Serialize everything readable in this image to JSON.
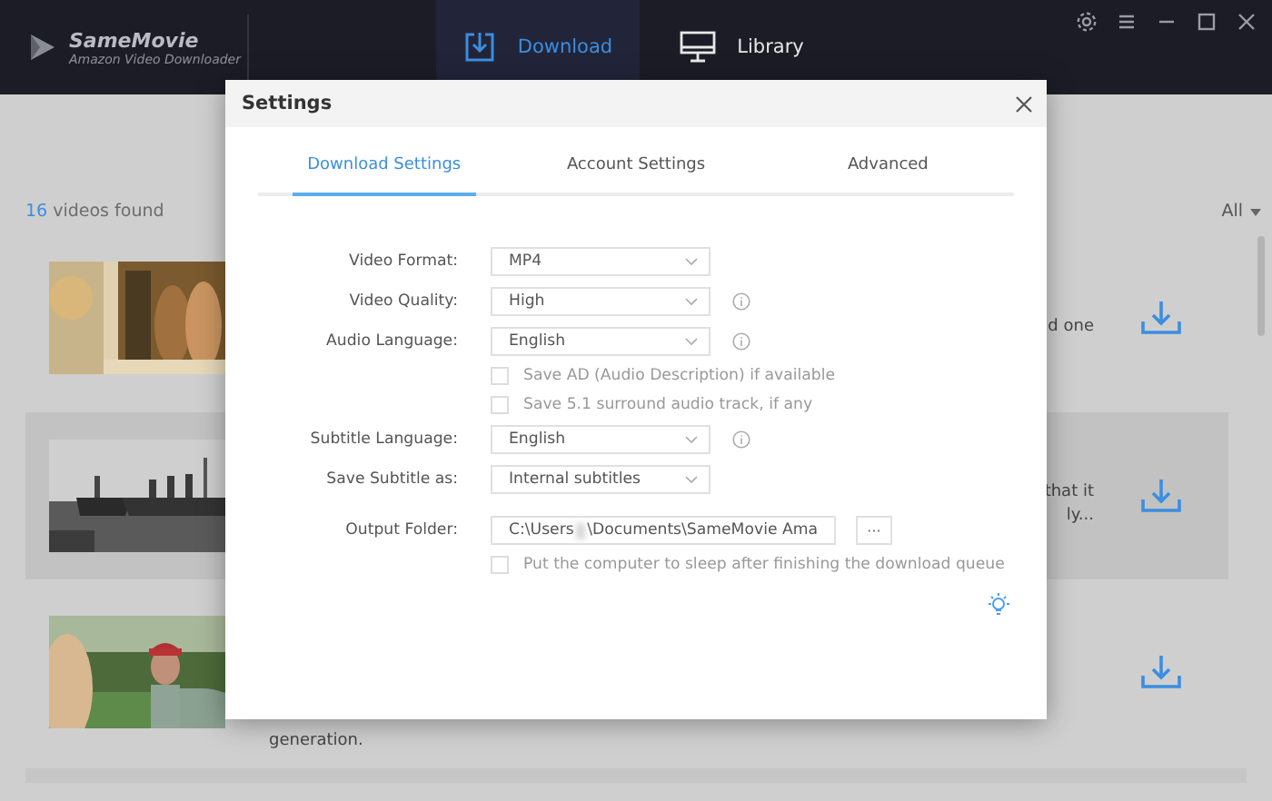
{
  "app": {
    "name": "SameMovie",
    "subtitle": "Amazon Video Downloader"
  },
  "nav_tabs": [
    {
      "label": "Download",
      "selected": true
    },
    {
      "label": "Library",
      "selected": false
    }
  ],
  "video_list": {
    "count": "16",
    "count_label": "videos found",
    "filter": "All",
    "rows": [
      {
        "highlighted": false,
        "description_lines": [
          "d one"
        ]
      },
      {
        "highlighted": true,
        "description_lines": [
          "that it",
          "ly..."
        ]
      },
      {
        "highlighted": false,
        "description_lines": [
          "generation."
        ]
      }
    ]
  },
  "dialog": {
    "title": "Settings",
    "tabs": [
      {
        "label": "Download Settings",
        "selected": true
      },
      {
        "label": "Account Settings",
        "selected": false
      },
      {
        "label": "Advanced",
        "selected": false
      }
    ],
    "fields": [
      {
        "kind": "select",
        "label": "Video Format:",
        "value": "MP4",
        "info": false
      },
      {
        "kind": "select",
        "label": "Video Quality:",
        "value": "High",
        "info": true
      },
      {
        "kind": "select",
        "label": "Audio Language:",
        "value": "English",
        "info": true
      },
      {
        "kind": "checkbox",
        "label": "Save AD (Audio Description) if available",
        "checked": false
      },
      {
        "kind": "checkbox",
        "label": "Save 5.1 surround audio track, if any",
        "checked": false
      },
      {
        "kind": "select",
        "label": "Subtitle Language:",
        "value": "English",
        "info": true
      },
      {
        "kind": "select",
        "label": "Save Subtitle as:",
        "value": "Internal subtitles",
        "info": false
      },
      {
        "kind": "folder",
        "label": "Output Folder:",
        "value_start": "C:\\Users",
        "value_end": "\\Documents\\SameMovie Ama",
        "browse": "···"
      },
      {
        "kind": "checkbox",
        "label": "Put the computer to sleep after finishing the download queue",
        "checked": false
      }
    ]
  }
}
